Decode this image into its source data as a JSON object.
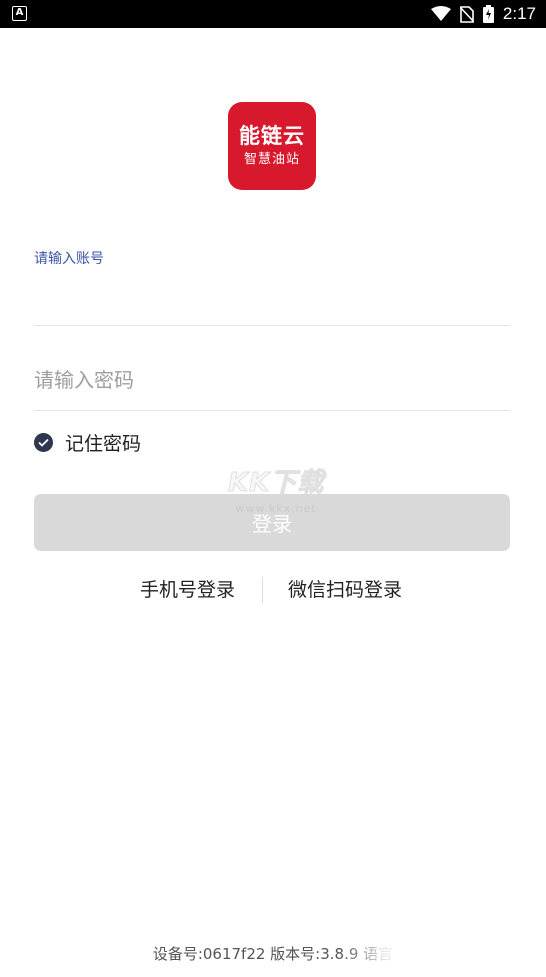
{
  "status_bar": {
    "time": "2:17",
    "left_icon": "app-notification-icon",
    "icons": [
      "wifi-icon",
      "no-sim-icon",
      "battery-charging-icon"
    ]
  },
  "logo": {
    "line1": "能链云",
    "line2": "智慧油站",
    "color": "#d8182d"
  },
  "account": {
    "label": "请输入账号",
    "value": ""
  },
  "password": {
    "placeholder": "请输入密码",
    "value": ""
  },
  "remember": {
    "label": "记住密码",
    "checked": true
  },
  "login_button": {
    "label": "登录"
  },
  "alt_login": {
    "phone": "手机号登录",
    "wechat": "微信扫码登录"
  },
  "watermark": {
    "title": "KK下载",
    "url": "www.kkx.net"
  },
  "footer": {
    "text": "设备号:0617f22 版本号:3.8.9 语言"
  }
}
